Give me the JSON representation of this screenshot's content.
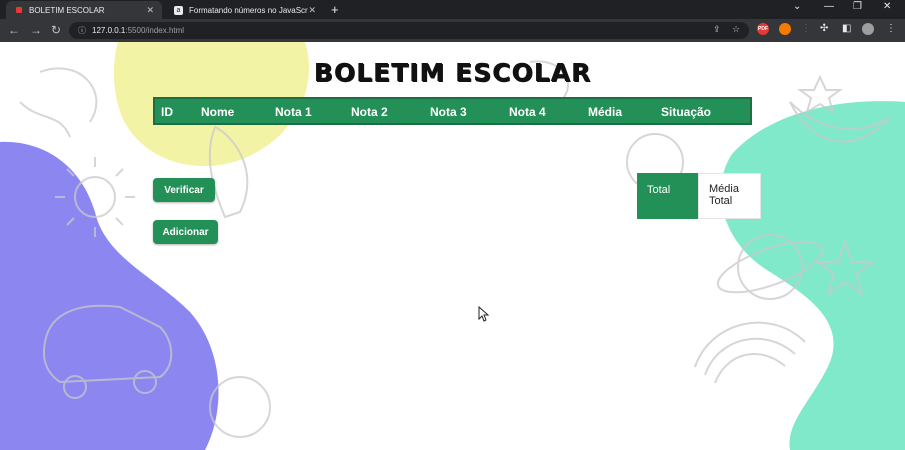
{
  "browser": {
    "tabs": [
      {
        "title": "BOLETIM ESCOLAR",
        "active": true
      },
      {
        "title": "Formatando números no JavaScr",
        "active": false
      }
    ],
    "url_host": "127.0.0.1",
    "url_rest": ":5500/index.html",
    "extensions": [
      {
        "label": "PDF",
        "color": "#e53935"
      },
      {
        "label": "",
        "color": "#f57c00"
      }
    ]
  },
  "page": {
    "title": "BOLETIM ESCOLAR",
    "table": {
      "headers": [
        "ID",
        "Nome",
        "Nota 1",
        "Nota 2",
        "Nota 3",
        "Nota 4",
        "Média",
        "Situação"
      ]
    },
    "buttons": {
      "verify": "Verificar",
      "add": "Adicionar"
    },
    "total": {
      "label": "Total",
      "value_line1": "Média",
      "value_line2": "Total"
    },
    "colors": {
      "accent": "#239157",
      "blob_yellow": "#f3f3a6",
      "blob_purple": "#8c86f0",
      "blob_mint": "#7fe9c9"
    }
  }
}
